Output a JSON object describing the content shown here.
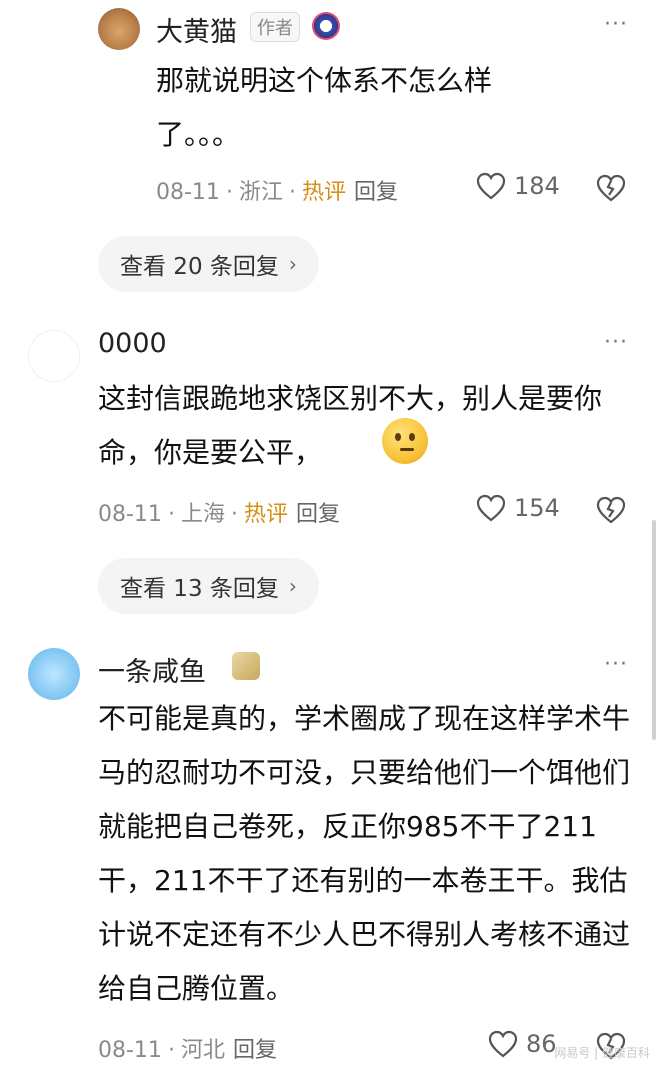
{
  "comments": [
    {
      "user": "大黄猫",
      "author_tag": "作者",
      "text": "那就说明这个体系不怎么样了。。。",
      "date": "08-11",
      "location": "浙江",
      "hot": "热评",
      "reply": "回复",
      "likes": "184",
      "view_replies": "查看 20 条回复"
    },
    {
      "user": "0000",
      "text": "这封信跟跪地求饶区别不大，别人是要你命，你是要公平，",
      "date": "08-11",
      "location": "上海",
      "hot": "热评",
      "reply": "回复",
      "likes": "154",
      "view_replies": "查看 13 条回复"
    },
    {
      "user": "一条咸鱼",
      "text": "不可能是真的，学术圈成了现在这样学术牛马的忍耐功不可没，只要给他们一个饵他们就能把自己卷死，反正你985不干了211干，211不干了还有别的一本卷王干。我估计说不定还有不少人巴不得别人考核不通过给自己腾位置。",
      "date": "08-11",
      "location": "河北",
      "reply": "回复",
      "likes": "86"
    }
  ],
  "more_icon": "···",
  "watermark": "网易号 | 健康百科",
  "icons": {
    "like": "heart-outline-icon",
    "dislike": "broken-heart-icon",
    "more": "more-dots-icon",
    "chevron": "chevron-right-icon"
  },
  "colors": {
    "hot": "#d58f14",
    "meta": "#8a8a8a",
    "pill": "#f4f4f4"
  }
}
